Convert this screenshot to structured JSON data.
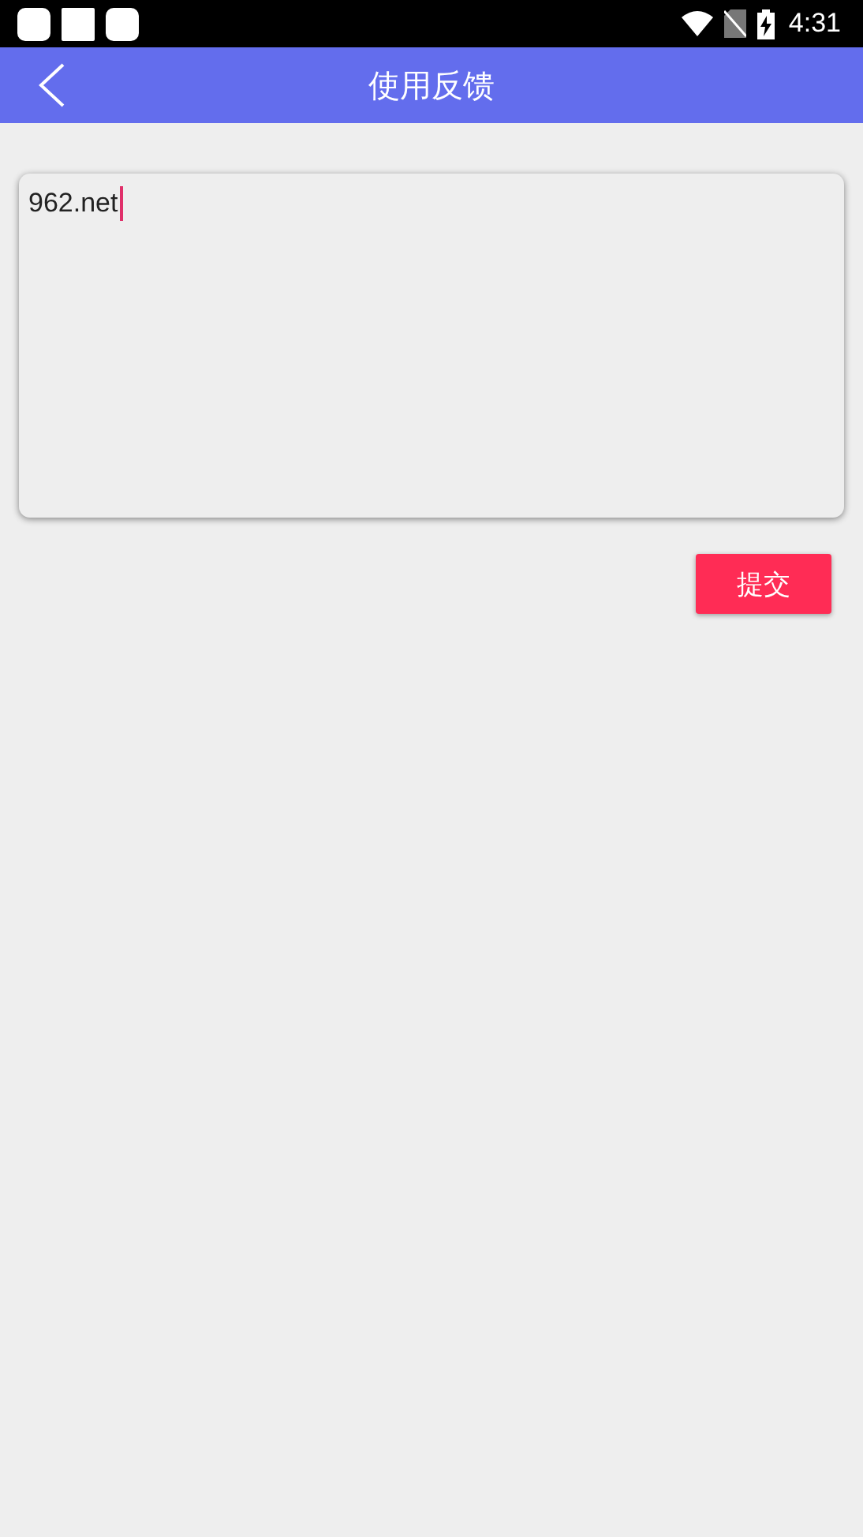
{
  "status_bar": {
    "time": "4:31"
  },
  "header": {
    "title": "使用反馈"
  },
  "feedback": {
    "value": "962.net",
    "focused": true
  },
  "buttons": [
    {
      "label": "提交"
    }
  ]
}
